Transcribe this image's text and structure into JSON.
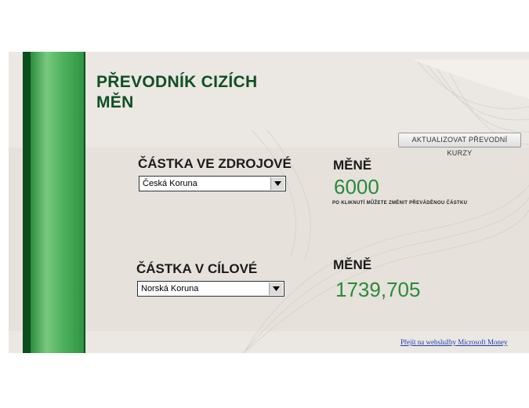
{
  "app": {
    "title": "PŘEVODNÍK CIZÍCH MĚN",
    "refresh_button": "AKTUALIZOVAT PŘEVODNÍ KURZY"
  },
  "source": {
    "label": "ČÁSTKA VE ZDROJOVÉ",
    "currency_suffix": "MĚNĚ",
    "selected_currency": "Česká Koruna",
    "amount": "6000",
    "hint": "PO KLIKNUTÍ MŮŽETE ZMĚNIT PŘEVÁDĚNOU ČÁSTKU"
  },
  "target": {
    "label": "ČÁSTKA V CÍLOVÉ",
    "currency_suffix": "MĚNĚ",
    "selected_currency": "Norská Koruna",
    "amount": "1739,705"
  },
  "footer": {
    "link": "Přejít na webslužby Microsoft Money"
  },
  "icons": {
    "dropdown": "triangle-down-icon"
  },
  "colors": {
    "brand_dark_green": "#0f4f23",
    "bar_green": "#4fb15d",
    "amount_green": "#2a8a3a",
    "panel_bg": "#e6e1db",
    "link_blue": "#1f3fb0"
  }
}
